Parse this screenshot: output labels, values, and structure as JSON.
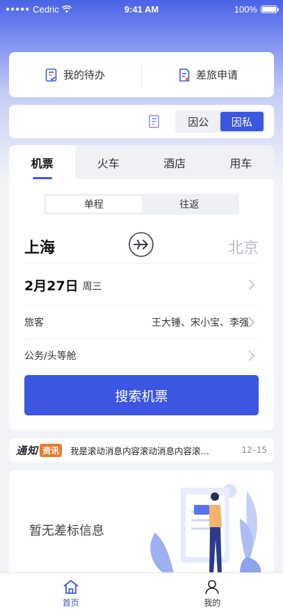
{
  "status_bar": {
    "signal_dots": "●●●●●",
    "carrier": "Cedric",
    "time": "9:41 AM",
    "battery": "100%"
  },
  "quick_actions": [
    {
      "label": "我的待办",
      "icon": "todo-icon"
    },
    {
      "label": "差旅申请",
      "icon": "travel-request-icon"
    }
  ],
  "mode": {
    "options": [
      "因公",
      "因私"
    ],
    "selected": "因私"
  },
  "tabs": [
    "机票",
    "火车",
    "酒店",
    "用车"
  ],
  "active_tab": "机票",
  "trip_type": {
    "options": [
      "单程",
      "往返"
    ],
    "selected": "单程"
  },
  "flight": {
    "from_city": "上海",
    "to_city": "北京",
    "date": "2月27日",
    "weekday": "周三",
    "passenger_label": "旅客",
    "passengers": "王大锤、宋小宝、李强",
    "cabin": "公务/头等舱",
    "search_label": "搜索机票"
  },
  "notice": {
    "logo_text": "通知",
    "badge": "资讯",
    "text": "我是滚动消息内容滚动消息内容滚动消息内容",
    "date": "12–15"
  },
  "policy": {
    "empty_text": "暂无差标信息"
  },
  "tabbar": [
    {
      "label": "首页",
      "icon": "home-icon"
    },
    {
      "label": "我的",
      "icon": "profile-icon"
    }
  ],
  "active_tabbar": "首页",
  "colors": {
    "accent": "#3b56e0",
    "notice_badge": "#f07a2b",
    "muted_city": "#b8bcc6"
  }
}
